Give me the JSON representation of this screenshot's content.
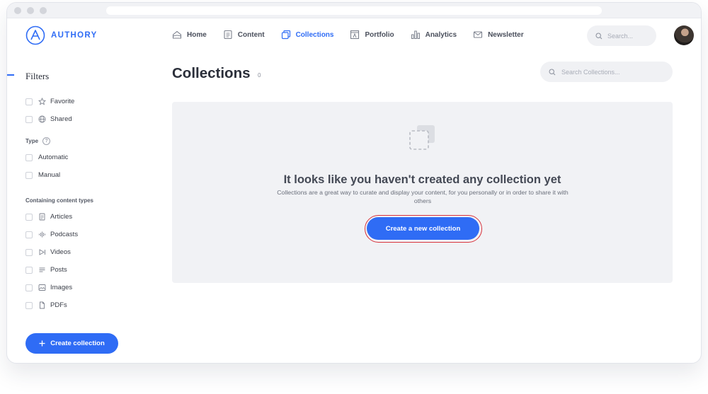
{
  "brand": {
    "name": "AUTHORY",
    "accent": "#2f6cf5"
  },
  "nav": {
    "items": [
      {
        "label": "Home",
        "icon": "home-icon"
      },
      {
        "label": "Content",
        "icon": "content-icon"
      },
      {
        "label": "Collections",
        "icon": "collections-icon",
        "active": true
      },
      {
        "label": "Portfolio",
        "icon": "portfolio-icon"
      },
      {
        "label": "Analytics",
        "icon": "analytics-icon"
      },
      {
        "label": "Newsletter",
        "icon": "newsletter-icon"
      }
    ],
    "search_placeholder": "Search..."
  },
  "sidebar": {
    "title": "Filters",
    "general": [
      {
        "label": "Favorite",
        "icon": "star-icon"
      },
      {
        "label": "Shared",
        "icon": "globe-icon"
      }
    ],
    "type_label": "Type",
    "type_help": "?",
    "types": [
      {
        "label": "Automatic"
      },
      {
        "label": "Manual"
      }
    ],
    "content_types_label": "Containing content types",
    "content_types": [
      {
        "label": "Articles",
        "icon": "article-icon"
      },
      {
        "label": "Podcasts",
        "icon": "podcast-icon"
      },
      {
        "label": "Videos",
        "icon": "video-icon"
      },
      {
        "label": "Posts",
        "icon": "posts-icon"
      },
      {
        "label": "Images",
        "icon": "image-icon"
      },
      {
        "label": "PDFs",
        "icon": "pdf-icon"
      }
    ],
    "create_button": "Create collection"
  },
  "main": {
    "title": "Collections",
    "count": "0",
    "search_placeholder": "Search Collections...",
    "empty": {
      "title": "It looks like you haven't created any collection yet",
      "description": "Collections are a great way to curate and display your content, for you personally or in order to share it with others",
      "cta": "Create a new collection"
    }
  },
  "colors": {
    "primary": "#2f6cf5",
    "highlight_ring": "#d9323a",
    "panel": "#f1f2f5"
  }
}
